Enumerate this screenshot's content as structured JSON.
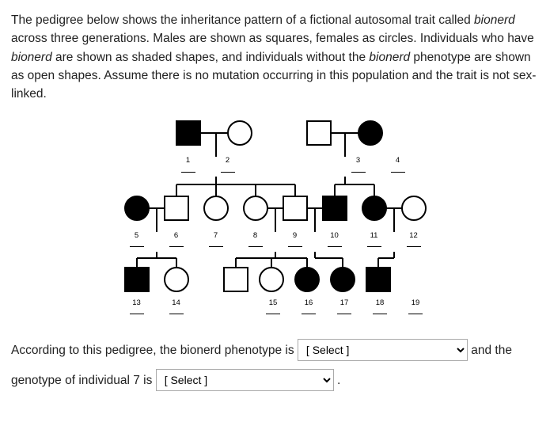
{
  "prompt": {
    "t1": "The pedigree below shows the inheritance pattern of a fictional autosomal trait called ",
    "trait": "bionerd",
    "t2": " across three generations. Males are shown as squares, females as circles. Individuals who have ",
    "t3": " are shown as shaded shapes, and individuals without the ",
    "t4": " phenotype are shown as open shapes. Assume there is no mutation occurring in this population and the trait is not sex-linked."
  },
  "generation1": {
    "ind1": "1",
    "ind2": "2",
    "ind3": "3",
    "ind4": "4"
  },
  "generation2": {
    "ind5": "5",
    "ind6": "6",
    "ind7": "7",
    "ind8": "8",
    "ind9": "9",
    "ind10": "10",
    "ind11": "11",
    "ind12": "12"
  },
  "generation3": {
    "ind13": "13",
    "ind14": "14",
    "ind15": "15",
    "ind16": "16",
    "ind17": "17",
    "ind18": "18",
    "ind19": "19"
  },
  "question": {
    "q1a": "According to this pedigree, the ",
    "q1b": " phenotype is ",
    "q1c": " and the genotype of individual 7 is ",
    "period": " .",
    "and_the": " and the"
  },
  "selects": {
    "placeholder": "[ Select ]"
  }
}
